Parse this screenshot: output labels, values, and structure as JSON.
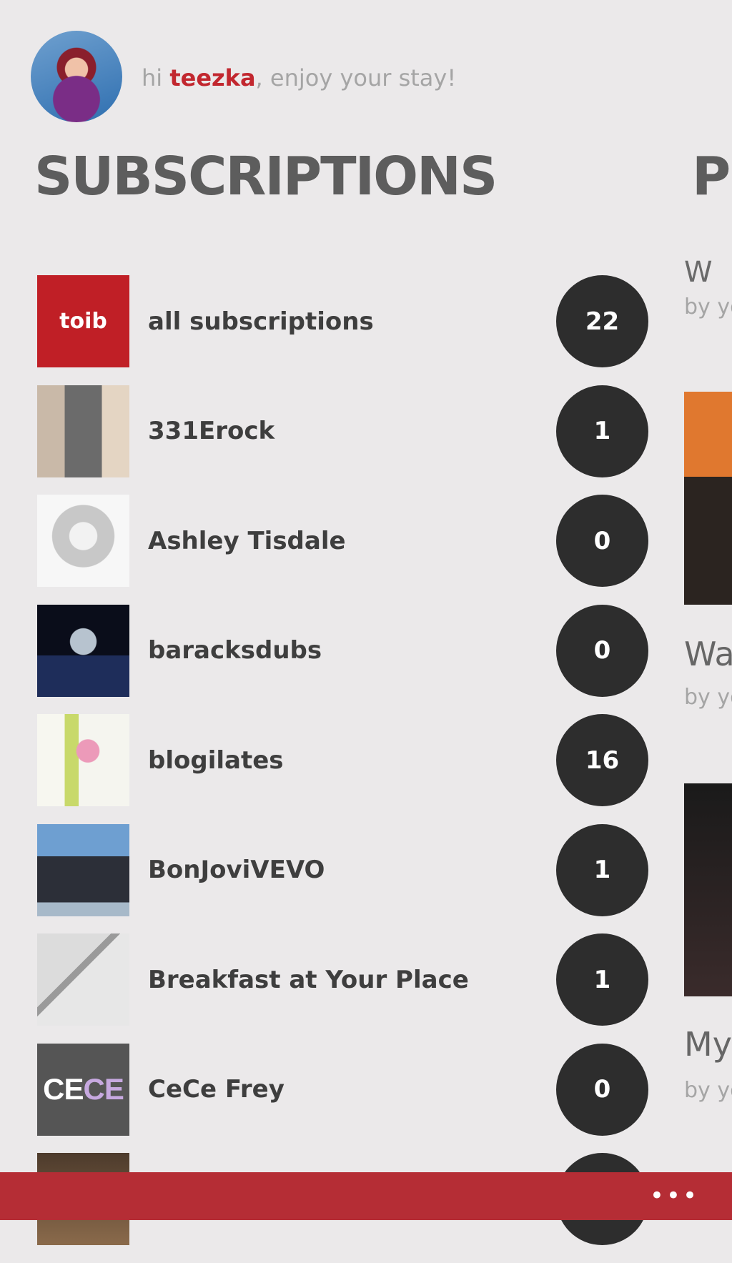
{
  "header": {
    "greeting_prefix": "hi ",
    "username": "teezka",
    "greeting_suffix": ", enjoy your stay!"
  },
  "sections": {
    "subscriptions_title": "SUBSCRIPTIONS",
    "next_title_partial": "P"
  },
  "subscriptions": [
    {
      "name": "all subscriptions",
      "count": "22",
      "thumb_label": "toib"
    },
    {
      "name": "331Erock",
      "count": "1"
    },
    {
      "name": "Ashley Tisdale",
      "count": "0"
    },
    {
      "name": "baracksdubs",
      "count": "0"
    },
    {
      "name": "blogilates",
      "count": "16"
    },
    {
      "name": "BonJoviVEVO",
      "count": "1"
    },
    {
      "name": "Breakfast at Your Place",
      "count": "1"
    },
    {
      "name": "CeCe Frey",
      "count": "0",
      "thumb_label_a": "CE",
      "thumb_label_b": "CE"
    }
  ],
  "right_column": {
    "partial_title_1": "W",
    "by_1": "by yo",
    "title_2": "Wa",
    "by_2": "by yo",
    "title_3": "My",
    "by_3": "by yo"
  },
  "app_bar": {
    "more_label": "•••"
  },
  "colors": {
    "accent": "#c2272f",
    "app_bar": "#b52d35",
    "badge": "#2d2d2d",
    "background": "#ebe9ea"
  }
}
